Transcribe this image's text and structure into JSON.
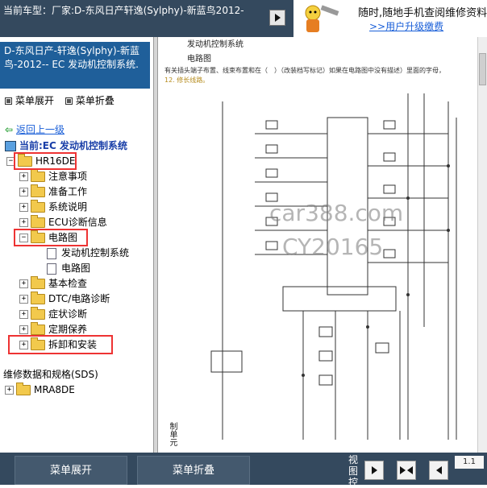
{
  "header": {
    "car_label": "当前车型：厂家:D-东风日产轩逸(Sylphy)-新蓝鸟2012-",
    "ad_line1": "随时,随地手机查阅维修资料",
    "ad_line2": ">>用户升级缴费"
  },
  "sidebar": {
    "title": "D-东风日产-轩逸(Sylphy)-新蓝鸟-2012-- EC 发动机控制系统.",
    "expand_menu": "菜单展开",
    "collapse_menu": "菜单折叠",
    "back": "返回上一级",
    "current": "当前:EC 发动机控制系统",
    "tree": [
      {
        "label": "HR16DE",
        "expanded": true
      },
      {
        "label": "注意事项"
      },
      {
        "label": "准备工作"
      },
      {
        "label": "系统说明"
      },
      {
        "label": "ECU诊断信息"
      },
      {
        "label": "电路图",
        "expanded": true
      },
      {
        "label": "发动机控制系统"
      },
      {
        "label": "电路图"
      },
      {
        "label": "基本检查"
      },
      {
        "label": "DTC/电路诊断"
      },
      {
        "label": "症状诊断"
      },
      {
        "label": "定期保养"
      },
      {
        "label": "拆卸和安装"
      },
      {
        "label": "维修数据和规格(SDS)"
      },
      {
        "label": "MRA8DE"
      }
    ]
  },
  "document": {
    "title": "发动机控制系统",
    "subtitle": "电路图",
    "note": "有关插头端子布置、线束布置和在（　）（改装档写标记）如果在电路图中没有描述）里面的字母，",
    "note2": "12. 修长线路。",
    "watermark1": "car388.com",
    "watermark2": "CY20165",
    "side_text": "制单元"
  },
  "bottom": {
    "expand_button": "菜单展开",
    "collapse_button": "菜单折叠",
    "view_label": "视图控",
    "page": "1.1"
  },
  "colors": {
    "header_bg": "#34495e",
    "sidebar_title_bg": "#1f5f9a",
    "link": "#1a5fd8",
    "highlight": "#e33333"
  }
}
